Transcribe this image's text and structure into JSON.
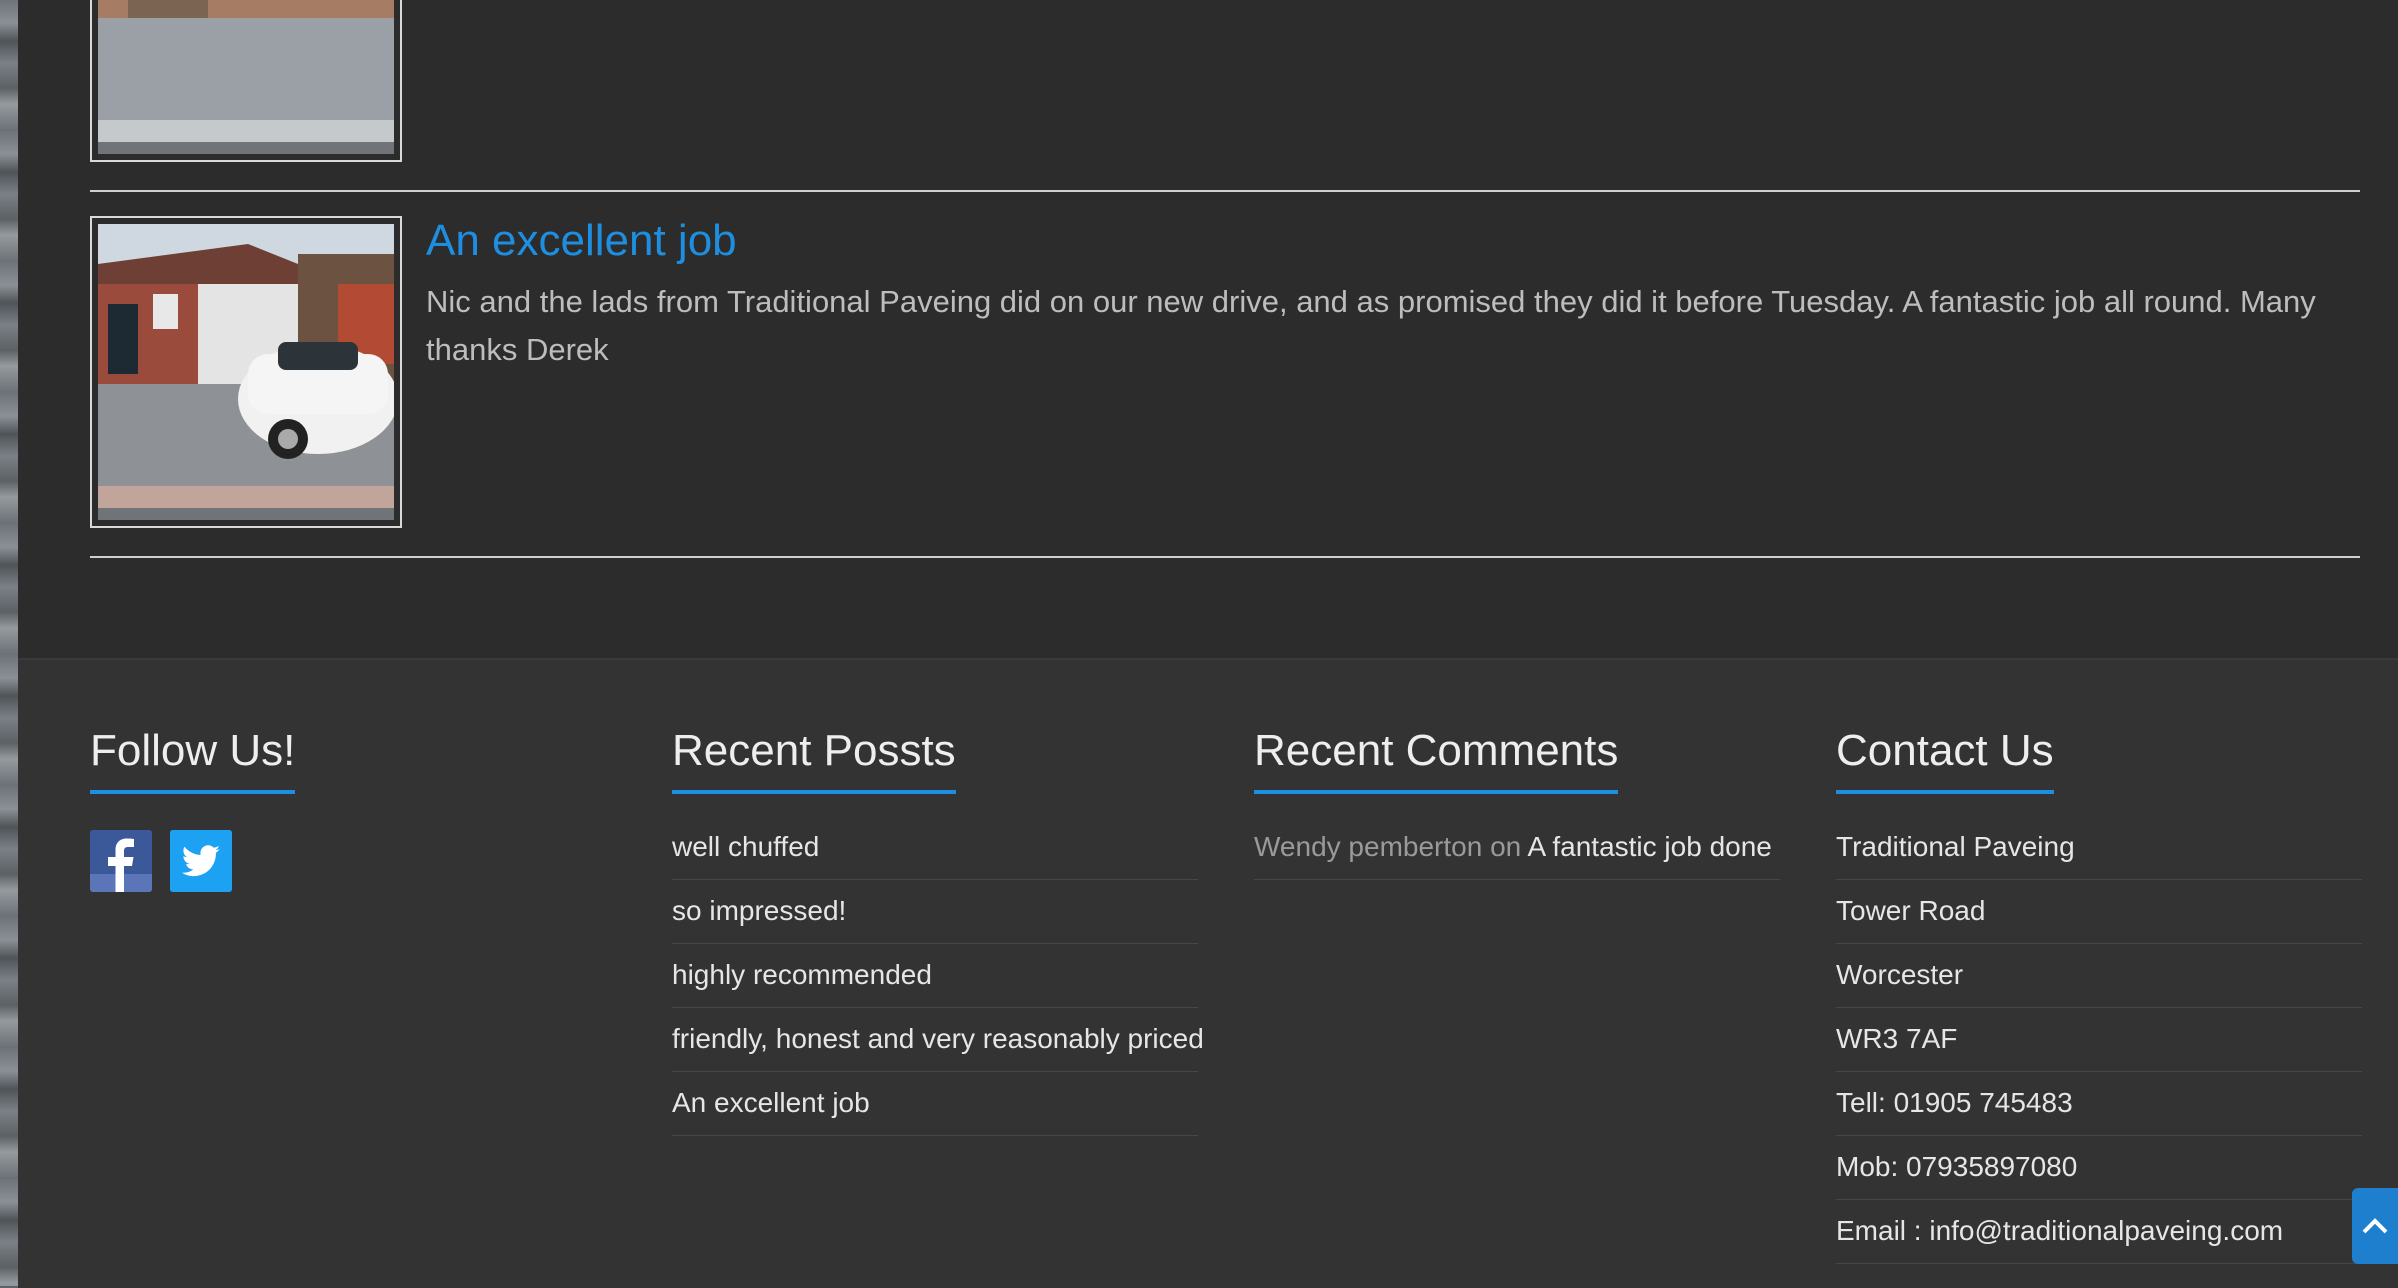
{
  "posts": [
    {
      "title": "",
      "excerpt": "",
      "image_alt": "paved driveway photo"
    },
    {
      "title": "An excellent job",
      "excerpt": "Nic and the lads from Traditional Paveing did  on our new drive, and as promised they did it before Tuesday. A fantastic job all round.   Many thanks Derek",
      "image_alt": "driveway with white car and garage"
    }
  ],
  "footer": {
    "follow": {
      "title": "Follow Us!",
      "icons": [
        "facebook-icon",
        "twitter-icon"
      ]
    },
    "recent_posts": {
      "title": "Recent Possts",
      "items": [
        "well chuffed",
        "so impressed!",
        "highly recommended",
        "friendly, honest and very reasonably priced",
        "An excellent job"
      ]
    },
    "recent_comments": {
      "title": "Recent Comments",
      "items": [
        {
          "author": "Wendy pemberton",
          "on": "on",
          "post": "A fantastic job done"
        }
      ]
    },
    "contact": {
      "title": "Contact Us",
      "items": [
        "Traditional Paveing",
        "Tower Road",
        "Worcester",
        "WR3 7AF",
        "Tell: 01905 745483",
        "Mob: 07935897080",
        "Email : info@traditionalpaveing.com"
      ]
    }
  },
  "colors": {
    "accent": "#1e8ee0",
    "background": "#2c2c2c",
    "footer_bg": "#333333"
  }
}
